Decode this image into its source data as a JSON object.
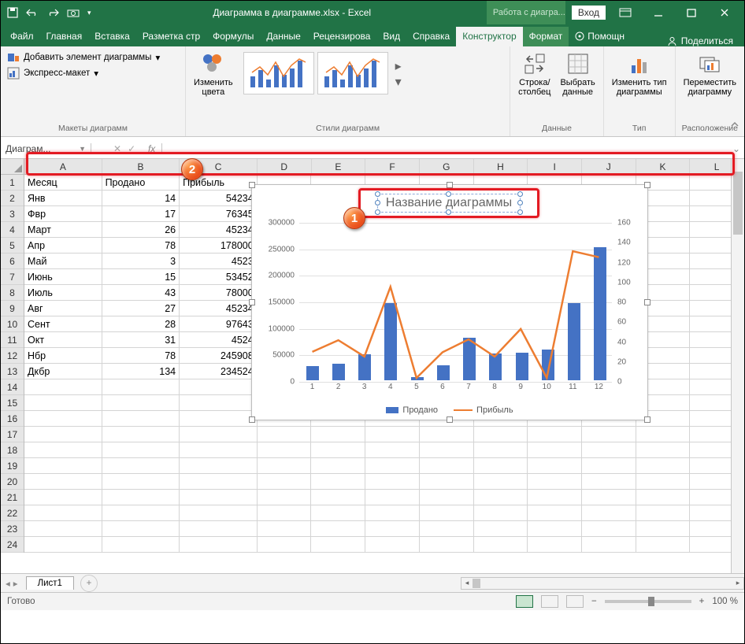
{
  "titlebar": {
    "filename": "Диаграмма в диаграмме.xlsx  -  Excel",
    "chart_tools": "Работа с диагра...",
    "login": "Вход"
  },
  "tabs": {
    "file": "Файл",
    "home": "Главная",
    "insert": "Вставка",
    "layout": "Разметка стр",
    "formulas": "Формулы",
    "data": "Данные",
    "review": "Рецензирова",
    "view": "Вид",
    "help": "Справка",
    "design": "Конструктор",
    "format": "Формат",
    "helpQ": "Помощн",
    "share": "Поделиться"
  },
  "ribbon": {
    "add_element": "Добавить элемент диаграммы",
    "quick_layout": "Экспресс-макет",
    "g_layouts": "Макеты диаграмм",
    "change_colors": "Изменить\nцвета",
    "g_styles": "Стили диаграмм",
    "switch": "Строка/\nстолбец",
    "select": "Выбрать\nданные",
    "g_data": "Данные",
    "change_type": "Изменить тип\nдиаграммы",
    "g_type": "Тип",
    "move": "Переместить\nдиаграмму",
    "g_location": "Расположение"
  },
  "namebox": "Диаграм...",
  "columns": [
    "A",
    "B",
    "C",
    "D",
    "E",
    "F",
    "G",
    "H",
    "I",
    "J",
    "K",
    "L"
  ],
  "table": {
    "headers": [
      "Месяц",
      "Продано",
      "Прибыль"
    ],
    "rows": [
      [
        "Янв",
        14,
        54234
      ],
      [
        "Фвр",
        17,
        76345
      ],
      [
        "Март",
        26,
        45234
      ],
      [
        "Апр",
        78,
        178000
      ],
      [
        "Май",
        3,
        4523
      ],
      [
        "Июнь",
        15,
        53452
      ],
      [
        "Июль",
        43,
        78000
      ],
      [
        "Авг",
        27,
        45234
      ],
      [
        "Сент",
        28,
        97643
      ],
      [
        "Окт",
        31,
        4524
      ],
      [
        "Нбр",
        78,
        245908
      ],
      [
        "Дкбр",
        134,
        234524
      ]
    ]
  },
  "chart": {
    "title": "Название диаграммы",
    "series1": "Продано",
    "series2": "Прибыль"
  },
  "chart_data": {
    "type": "bar+line",
    "categories": [
      1,
      2,
      3,
      4,
      5,
      6,
      7,
      8,
      9,
      10,
      11,
      12
    ],
    "series": [
      {
        "name": "Продано",
        "axis": "secondary",
        "type": "bar",
        "values": [
          14,
          17,
          26,
          78,
          3,
          15,
          43,
          27,
          28,
          31,
          78,
          134
        ]
      },
      {
        "name": "Прибыль",
        "axis": "primary",
        "type": "line",
        "values": [
          54234,
          76345,
          45234,
          178000,
          4523,
          53452,
          78000,
          45234,
          97643,
          4524,
          245908,
          234524
        ]
      }
    ],
    "ylim_primary": [
      0,
      300000
    ],
    "yticks_primary": [
      0,
      50000,
      100000,
      150000,
      200000,
      250000,
      300000
    ],
    "ylim_secondary": [
      0,
      160
    ],
    "yticks_secondary": [
      0,
      20,
      40,
      60,
      80,
      100,
      120,
      140,
      160
    ],
    "title": "Название диаграммы"
  },
  "sheet": "Лист1",
  "status": "Готово",
  "zoom": "100 %"
}
